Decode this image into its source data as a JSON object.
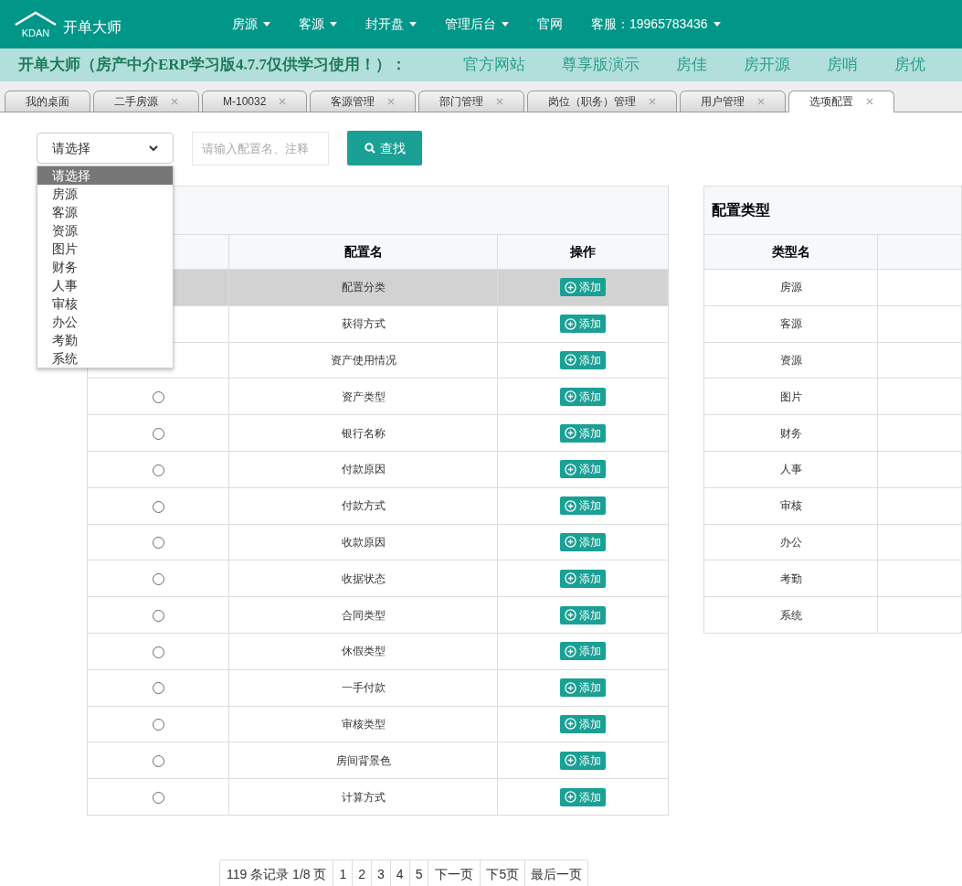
{
  "brand": {
    "name": "开单大师",
    "logo_text": "KDAN"
  },
  "nav": [
    {
      "label": "房源",
      "dropdown": true
    },
    {
      "label": "客源",
      "dropdown": true
    },
    {
      "label": "封开盘",
      "dropdown": true
    },
    {
      "label": "管理后台",
      "dropdown": true
    },
    {
      "label": "官网",
      "dropdown": false
    },
    {
      "label": "客服：19965783436",
      "dropdown": true
    }
  ],
  "banner": {
    "title": "开单大师（房产中介ERP学习版4.7.7仅供学习使用！）：",
    "links": [
      "官方网站",
      "尊享版演示",
      "房佳",
      "房开源",
      "房哨",
      "房优"
    ]
  },
  "tabs": [
    {
      "label": "我的桌面",
      "closable": false,
      "selected": false
    },
    {
      "label": "二手房源",
      "closable": true,
      "selected": false
    },
    {
      "label": "M-10032",
      "closable": true,
      "selected": false
    },
    {
      "label": "客源管理",
      "closable": true,
      "selected": false
    },
    {
      "label": "部门管理",
      "closable": true,
      "selected": false
    },
    {
      "label": "岗位（职务）管理",
      "closable": true,
      "selected": false
    },
    {
      "label": "用户管理",
      "closable": true,
      "selected": false
    },
    {
      "label": "选项配置",
      "closable": true,
      "selected": true
    }
  ],
  "filter": {
    "select_value": "请选择",
    "options": [
      {
        "label": "请选择",
        "selected": true
      },
      {
        "label": "房源",
        "selected": false
      },
      {
        "label": "客源",
        "selected": false
      },
      {
        "label": "资源",
        "selected": false
      },
      {
        "label": "图片",
        "selected": false
      },
      {
        "label": "财务",
        "selected": false
      },
      {
        "label": "人事",
        "selected": false
      },
      {
        "label": "审核",
        "selected": false
      },
      {
        "label": "办公",
        "selected": false
      },
      {
        "label": "考勤",
        "selected": false
      },
      {
        "label": "系统",
        "selected": false
      }
    ],
    "search_placeholder": "请输入配置名、注释",
    "search_button": "查找"
  },
  "config_table": {
    "columns": [
      "配置名",
      "操作"
    ],
    "rows": [
      {
        "kind": "plain",
        "name": "配置分类",
        "action": "添加",
        "selected": true
      },
      {
        "kind": "plain",
        "name": "获得方式",
        "action": "添加",
        "selected": false
      },
      {
        "kind": "plain",
        "name": "资产使用情况",
        "action": "添加",
        "selected": false
      },
      {
        "kind": "radio",
        "name": "资产类型",
        "action": "添加",
        "selected": false
      },
      {
        "kind": "radio",
        "name": "银行名称",
        "action": "添加",
        "selected": false
      },
      {
        "kind": "radio",
        "name": "付款原因",
        "action": "添加",
        "selected": false
      },
      {
        "kind": "radio",
        "name": "付款方式",
        "action": "添加",
        "selected": false
      },
      {
        "kind": "radio",
        "name": "收款原因",
        "action": "添加",
        "selected": false
      },
      {
        "kind": "radio",
        "name": "收据状态",
        "action": "添加",
        "selected": false
      },
      {
        "kind": "radio",
        "name": "合同类型",
        "action": "添加",
        "selected": false
      },
      {
        "kind": "radio",
        "name": "休假类型",
        "action": "添加",
        "selected": false
      },
      {
        "kind": "radio",
        "name": "一手付款",
        "action": "添加",
        "selected": false
      },
      {
        "kind": "radio",
        "name": "审核类型",
        "action": "添加",
        "selected": false
      },
      {
        "kind": "radio",
        "name": "房间背景色",
        "action": "添加",
        "selected": false
      },
      {
        "kind": "radio",
        "name": "计算方式",
        "action": "添加",
        "selected": false
      }
    ]
  },
  "type_table": {
    "title": "配置类型",
    "columns": [
      "类型名"
    ],
    "rows": [
      "房源",
      "客源",
      "资源",
      "图片",
      "财务",
      "人事",
      "审核",
      "办公",
      "考勤",
      "系统"
    ]
  },
  "pagination": {
    "summary": "119 条记录 1/8 页",
    "pages": [
      "1",
      "2",
      "3",
      "4",
      "5"
    ],
    "next": "下一页",
    "next5": "下5页",
    "last": "最后一页"
  }
}
